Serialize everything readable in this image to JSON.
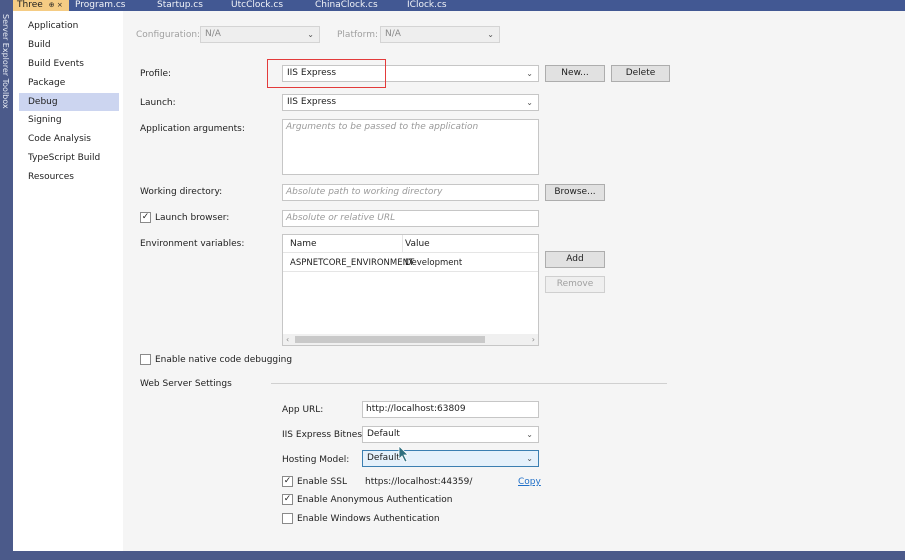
{
  "left_strip": {
    "label": "Server Explorer  Toolbox"
  },
  "tabs": [
    {
      "label": "Three",
      "pin": "⊕ ×",
      "active": true
    },
    {
      "label": "Program.cs"
    },
    {
      "label": "Startup.cs"
    },
    {
      "label": "UtcClock.cs"
    },
    {
      "label": "ChinaClock.cs"
    },
    {
      "label": "IClock.cs"
    }
  ],
  "nav": {
    "items": [
      "Application",
      "Build",
      "Build Events",
      "Package",
      "Debug",
      "Signing",
      "Code Analysis",
      "TypeScript Build",
      "Resources"
    ],
    "selected": "Debug"
  },
  "config": {
    "configuration_label": "Configuration:",
    "configuration_value": "N/A",
    "platform_label": "Platform:",
    "platform_value": "N/A"
  },
  "profile": {
    "label": "Profile:",
    "value": "IIS Express",
    "new_button": "New...",
    "delete_button": "Delete"
  },
  "launch": {
    "label": "Launch:",
    "value": "IIS Express"
  },
  "app_args": {
    "label": "Application arguments:",
    "placeholder": "Arguments to be passed to the application"
  },
  "working_dir": {
    "label": "Working directory:",
    "placeholder": "Absolute path to working directory",
    "browse_button": "Browse..."
  },
  "launch_browser": {
    "label": "Launch browser:",
    "checked": true,
    "placeholder": "Absolute or relative URL"
  },
  "env_vars": {
    "label": "Environment variables:",
    "columns": [
      "Name",
      "Value"
    ],
    "rows": [
      {
        "name": "ASPNETCORE_ENVIRONMENT",
        "value": "Development"
      }
    ],
    "add_button": "Add",
    "remove_button": "Remove"
  },
  "native_debug": {
    "label": "Enable native code debugging",
    "checked": false
  },
  "web_server": {
    "section_label": "Web Server Settings",
    "app_url_label": "App URL:",
    "app_url_value": "http://localhost:63809",
    "bitness_label": "IIS Express Bitness:",
    "bitness_value": "Default",
    "hosting_label": "Hosting Model:",
    "hosting_value": "Default",
    "ssl_label": "Enable SSL",
    "ssl_checked": true,
    "ssl_url": "https://localhost:44359/",
    "copy_link": "Copy",
    "anon_label": "Enable Anonymous Authentication",
    "anon_checked": true,
    "windows_label": "Enable Windows Authentication",
    "windows_checked": false
  },
  "icons": {
    "chevron": "chevron-down-icon",
    "check": "checkmark-icon"
  },
  "colors": {
    "tab_active": "#f5cc84",
    "nav_selected": "#ccd5f0",
    "highlight": "#e33b3b",
    "link": "#1f6fc8"
  }
}
